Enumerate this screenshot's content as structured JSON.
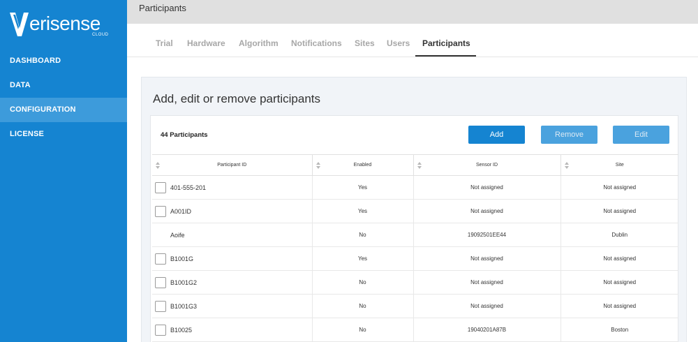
{
  "brand": {
    "name": "erisense",
    "sub": "CLOUD"
  },
  "sidebar": {
    "items": [
      {
        "label": "DASHBOARD"
      },
      {
        "label": "DATA"
      },
      {
        "label": "CONFIGURATION"
      },
      {
        "label": "LICENSE"
      }
    ],
    "active": "CONFIGURATION"
  },
  "topbar": {
    "title": "Participants"
  },
  "tabs": [
    {
      "label": "Trial"
    },
    {
      "label": "Hardware"
    },
    {
      "label": "Algorithm"
    },
    {
      "label": "Notifications"
    },
    {
      "label": "Sites"
    },
    {
      "label": "Users"
    },
    {
      "label": "Participants"
    }
  ],
  "panel": {
    "title": "Add, edit or remove participants",
    "count": "44 Participants",
    "buttons": {
      "add": "Add",
      "remove": "Remove",
      "edit": "Edit"
    }
  },
  "table": {
    "headers": [
      "Participant ID",
      "Enabled",
      "Sensor ID",
      "Site"
    ],
    "rows": [
      {
        "id": "401-555-201",
        "enabled": "Yes",
        "sensor": "Not assigned",
        "site": "Not assigned"
      },
      {
        "id": "A001ID",
        "enabled": "Yes",
        "sensor": "Not assigned",
        "site": "Not assigned"
      },
      {
        "id": "Aoife",
        "enabled": "No",
        "sensor": "19092501EE44",
        "site": "Dublin"
      },
      {
        "id": "B1001G",
        "enabled": "Yes",
        "sensor": "Not assigned",
        "site": "Not assigned"
      },
      {
        "id": "B1001G2",
        "enabled": "No",
        "sensor": "Not assigned",
        "site": "Not assigned"
      },
      {
        "id": "B1001G3",
        "enabled": "No",
        "sensor": "Not assigned",
        "site": "Not assigned"
      },
      {
        "id": "B10025",
        "enabled": "No",
        "sensor": "19040201A87B",
        "site": "Boston"
      }
    ]
  },
  "colors": {
    "sidebar": "#1584d1",
    "active_nav": "#3d9bdb",
    "primary_button": "#1584d1",
    "disabled_button": "#4aa2de"
  }
}
